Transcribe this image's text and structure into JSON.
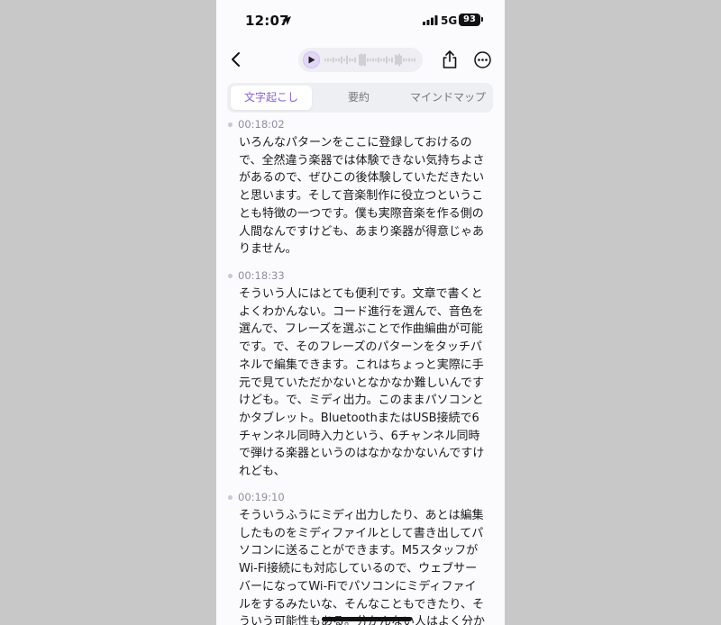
{
  "status_bar": {
    "time": "12:07",
    "network": "5G",
    "battery": "93"
  },
  "header": {},
  "tabs": [
    {
      "label": "文字起こし",
      "active": true
    },
    {
      "label": "要約",
      "active": false
    },
    {
      "label": "マインドマップ",
      "active": false
    }
  ],
  "transcript": [
    {
      "time": "00:18:02",
      "text": "いろんなパターンをここに登録しておけるの\nで、全然違う楽器では体験できない気持ちよさ\nがあるので、ぜひこの後体験していただきたい\nと思います。そして音楽制作に役立つというこ\nとも特徴の一つです。僕も実際音楽を作る側の\n人間なんですけども、あまり楽器が得意じゃあ\nりません。"
    },
    {
      "time": "00:18:33",
      "text": "そういう人にはとても便利です。文章で書くと\nよくわかんない。コード進行を選んで、音色を\n選んで、フレーズを選ぶことで作曲編曲が可能\nです。で、そのフレーズのパターンをタッチパ\nネルで編集できます。これはちょっと実際に手\n元で見ていただかないとなかなか難しいんです\nけども。で、ミディ出力。このままパソコンと\nかタブレット。BluetoothまたはUSB接続で6\nチャンネル同時入力という、6チャンネル同時\nで弾ける楽器というのはなかなかないんですけ\nれども、"
    },
    {
      "time": "00:19:10",
      "text": "そういうふうにミディ出力したり、あとは編集\nしたものをミディファイルとして書き出してパ\nソコンに送ることができます。M5スタッフが\nWi-Fi接続にも対応しているので、ウェブサー\nバーになってWi-Fiでパソコンにミディファイ\nルをするみたいな、そんなこともできたり、そ\nういう可能性もある。分かんない人はよく分か"
    }
  ],
  "icons": {
    "back": "chevron-left-icon",
    "play": "play-icon",
    "waveform": "waveform-icon",
    "share": "share-icon",
    "more": "more-icon",
    "location": "location-arrow-icon",
    "signal": "cellular-signal-icon",
    "battery": "battery-icon"
  },
  "colors": {
    "accent": "#8a5bd2",
    "background": "#fbfbfd",
    "backdrop": "#c8c8c8"
  }
}
